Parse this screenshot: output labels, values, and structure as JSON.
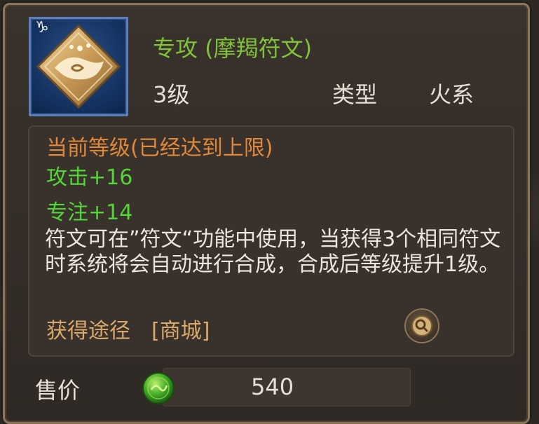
{
  "item": {
    "sign_glyph": "♑",
    "icon": "capricorn-rune-icon",
    "title": "专攻 (摩羯符文)",
    "level": "3级",
    "type_label": "类型",
    "type_value": "火系"
  },
  "details": {
    "current_level": "当前等级(已经达到上限)",
    "attack": "攻击+16",
    "focus": "专注+14",
    "description": "符文可在”符文“功能中使用，当获得3个相同符文时系统将会自动进行合成，合成后等级提升1级。",
    "source_label": "获得途径",
    "source_value": "[商城]"
  },
  "price": {
    "label": "售价",
    "value": "540"
  },
  "colors": {
    "title": "#7ec33a",
    "stat": "#52d63a",
    "level_header": "#e2883b",
    "source": "#d9a86b",
    "icon_border": "#5d7fb8",
    "frame_border": "#8c7656"
  }
}
